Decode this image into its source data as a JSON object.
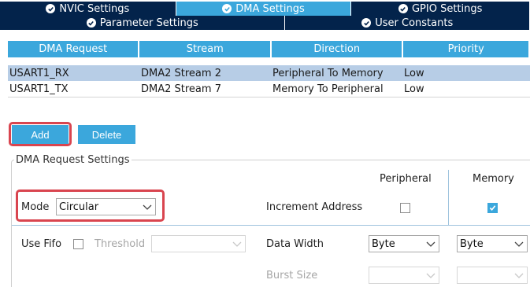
{
  "tabs_row1": [
    {
      "label": "NVIC Settings",
      "active": false
    },
    {
      "label": "DMA Settings",
      "active": true
    },
    {
      "label": "GPIO Settings",
      "active": false
    }
  ],
  "tabs_row2": [
    {
      "label": "Parameter Settings"
    },
    {
      "label": "User Constants"
    }
  ],
  "table": {
    "headers": [
      "DMA Request",
      "Stream",
      "Direction",
      "Priority"
    ],
    "rows": [
      {
        "request": "USART1_RX",
        "stream": "DMA2 Stream 2",
        "direction": "Peripheral To Memory",
        "priority": "Low",
        "selected": true
      },
      {
        "request": "USART1_TX",
        "stream": "DMA2 Stream 7",
        "direction": "Memory To Peripheral",
        "priority": "Low",
        "selected": false
      }
    ]
  },
  "buttons": {
    "add": "Add",
    "delete": "Delete"
  },
  "settings": {
    "title": "DMA Request Settings",
    "peripheral_header": "Peripheral",
    "memory_header": "Memory",
    "mode_label": "Mode",
    "mode_value": "Circular",
    "increment_address_label": "Increment Address",
    "peripheral_increment": false,
    "memory_increment": true,
    "use_fifo_label": "Use Fifo",
    "use_fifo": false,
    "threshold_label": "Threshold",
    "threshold_value": "",
    "data_width_label": "Data Width",
    "peripheral_data_width": "Byte",
    "memory_data_width": "Byte",
    "burst_size_label": "Burst Size",
    "peripheral_burst": "",
    "memory_burst": ""
  },
  "colors": {
    "accent": "#3ba7dc",
    "tab_dark": "#03234b",
    "highlight": "#d9454f",
    "selected_row": "#b7cde6"
  },
  "icons": {
    "tab_check": "check-circle-icon",
    "dropdown": "chevron-down-icon",
    "checkbox": "check-icon"
  }
}
